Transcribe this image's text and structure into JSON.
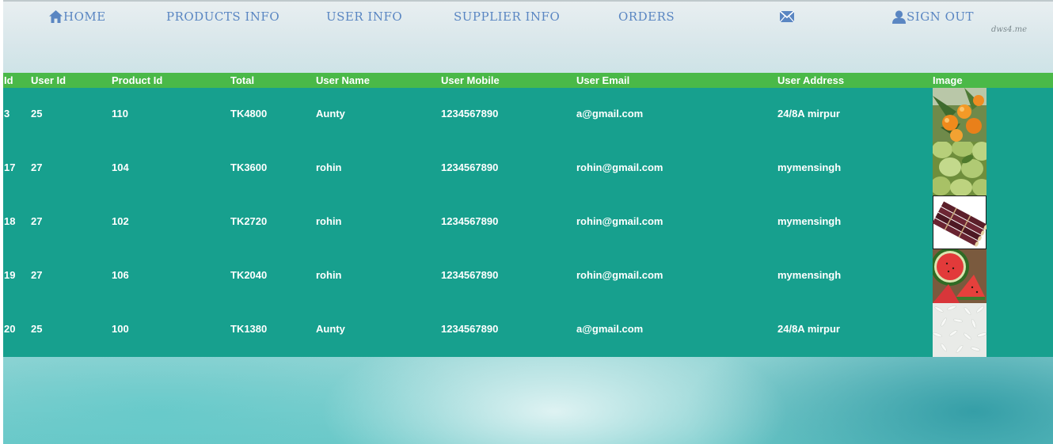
{
  "nav": {
    "home": "HOME",
    "products_info": "PRODUCTS INFO",
    "user_info": "USER INFO",
    "supplier_info": "SUPPLIER INFO",
    "orders": "ORDERS",
    "mail_icon": "envelope-icon",
    "sign_out": "SIGN OUT",
    "home_icon": "home-icon",
    "user_icon": "user-icon"
  },
  "watermark": "dws4.me",
  "table": {
    "headers": [
      "Id",
      "User Id",
      "Product Id",
      "Total",
      "User Name",
      "User Mobile",
      "User Email",
      "User Address",
      "Image"
    ],
    "rows": [
      {
        "id": "3",
        "user_id": "25",
        "product_id": "110",
        "total": "TK4800",
        "user_name": "Aunty",
        "user_mobile": "1234567890",
        "user_email": "a@gmail.com",
        "user_address": "24/8A mirpur",
        "image": "oranges"
      },
      {
        "id": "17",
        "user_id": "27",
        "product_id": "104",
        "total": "TK3600",
        "user_name": "rohin",
        "user_mobile": "1234567890",
        "user_email": "rohin@gmail.com",
        "user_address": "mymensingh",
        "image": "guavas"
      },
      {
        "id": "18",
        "user_id": "27",
        "product_id": "102",
        "total": "TK2720",
        "user_name": "rohin",
        "user_mobile": "1234567890",
        "user_email": "rohin@gmail.com",
        "user_address": "mymensingh",
        "image": "sugarcane"
      },
      {
        "id": "19",
        "user_id": "27",
        "product_id": "106",
        "total": "TK2040",
        "user_name": "rohin",
        "user_mobile": "1234567890",
        "user_email": "rohin@gmail.com",
        "user_address": "mymensingh",
        "image": "watermelon"
      },
      {
        "id": "20",
        "user_id": "25",
        "product_id": "100",
        "total": "TK1380",
        "user_name": "Aunty",
        "user_mobile": "1234567890",
        "user_email": "a@gmail.com",
        "user_address": "24/8A mirpur",
        "image": "rice"
      }
    ]
  },
  "colors": {
    "nav_text": "#5a86c2",
    "header_bg": "#4ab948",
    "table_bg": "#17a08e",
    "cell_text": "#ffffff"
  }
}
